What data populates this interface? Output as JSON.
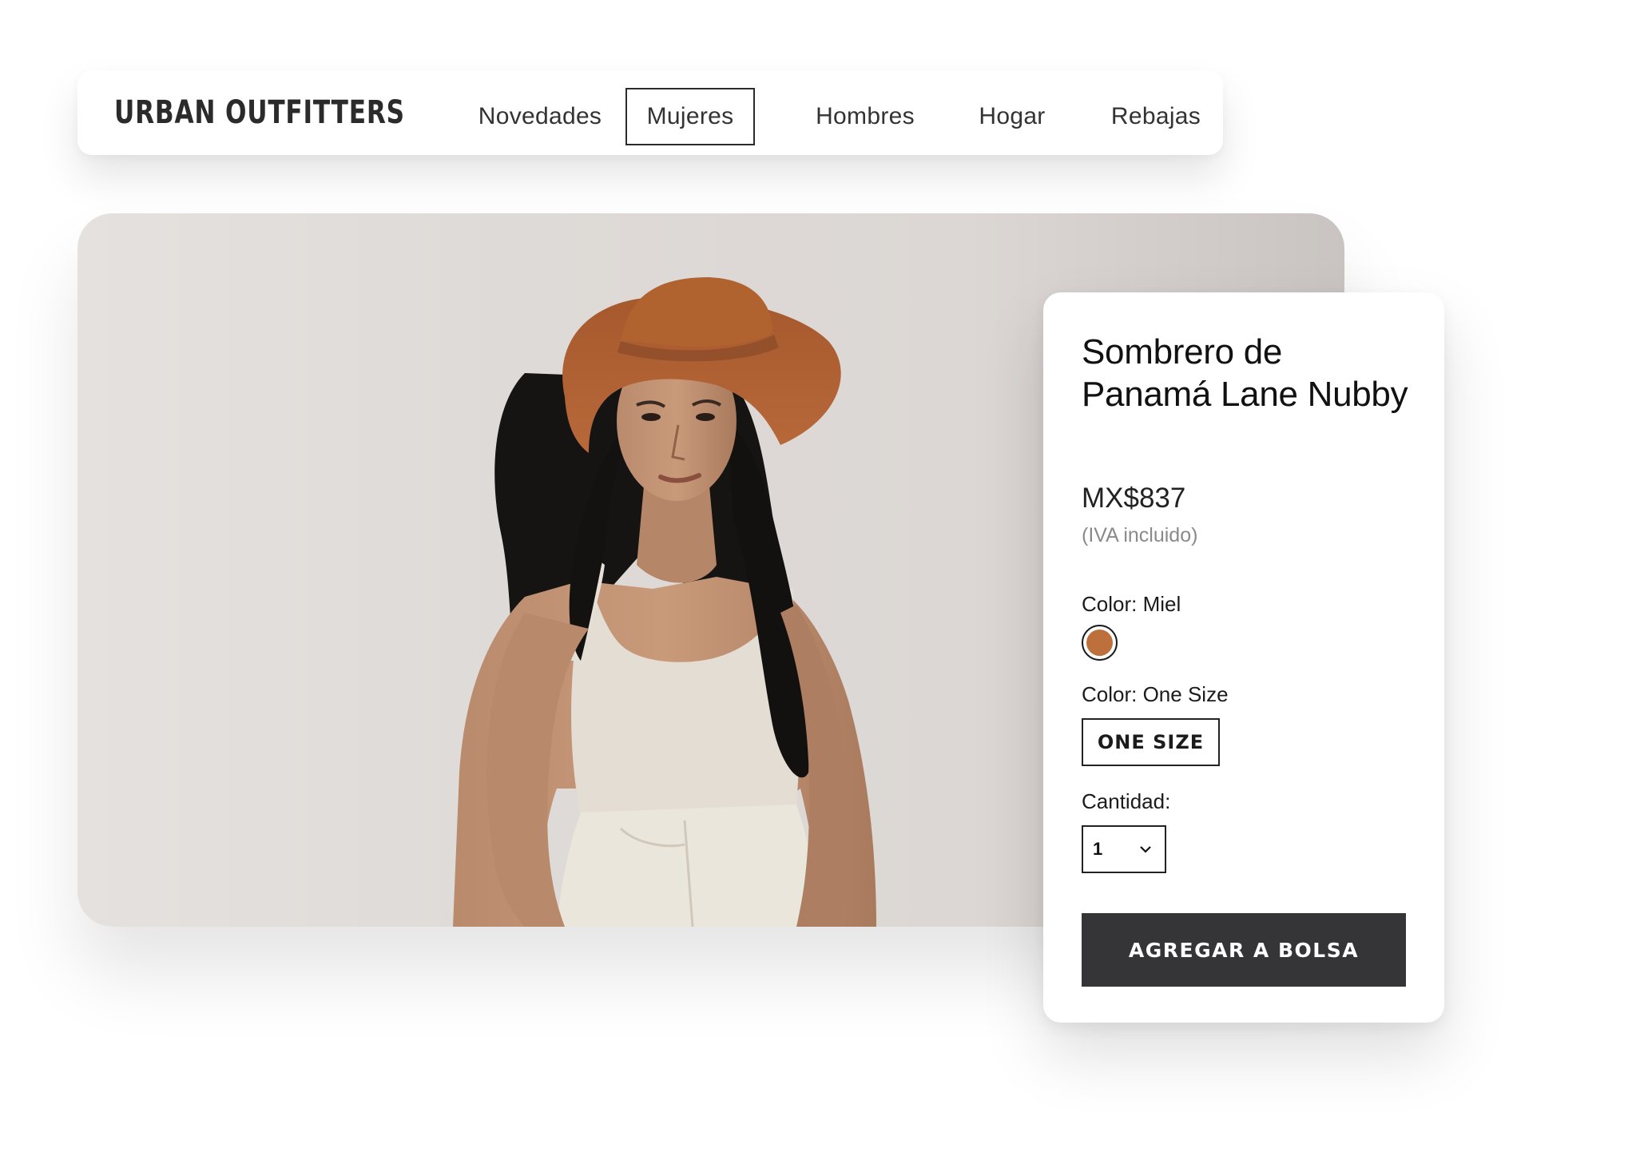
{
  "header": {
    "logo": "URBAN OUTFITTERS",
    "nav": [
      {
        "label": "Novedades",
        "active": false
      },
      {
        "label": "Mujeres",
        "active": true
      },
      {
        "label": "Hombres",
        "active": false
      },
      {
        "label": "Hogar",
        "active": false
      },
      {
        "label": "Rebajas",
        "active": false
      }
    ]
  },
  "product": {
    "title": "Sombrero de Panamá Lane Nubby",
    "price": "MX$837",
    "tax_note": "(IVA incluido)",
    "color_label": "Color: Miel",
    "swatch_color": "#bd6f3c",
    "size_label": "Color: One Size",
    "size_option": "ONE SIZE",
    "quantity_label": "Cantidad:",
    "quantity_value": "1",
    "add_button": "AGREGAR A BOLSA"
  },
  "colors": {
    "button_dark": "#353537",
    "hat": "#b5673a",
    "background": "#dedad7"
  },
  "icons": {
    "quantity_dropdown": "chevron-down-icon"
  }
}
